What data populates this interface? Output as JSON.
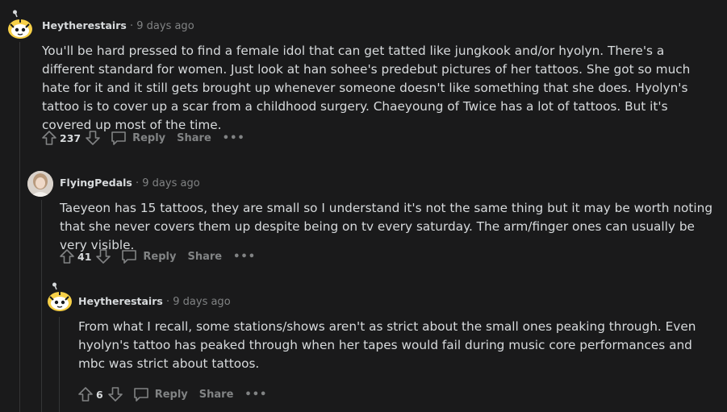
{
  "comments": [
    {
      "author": "Heytherestairs",
      "time": "9 days ago",
      "body": "You'll be hard pressed to find a female idol that can get tatted like jungkook and/or hyolyn. There's a different standard for women. Just look at han sohee's predebut pictures of her tattoos. She got so much hate for it and it still gets brought up whenever someone doesn't like something that she does. Hyolyn's tattoo is to cover up a scar from a childhood surgery. Chaeyoung of Twice has a lot of tattoos. But it's covered up most of the time.",
      "score": "237",
      "reply_label": "Reply",
      "share_label": "Share",
      "more_label": "•••"
    },
    {
      "author": "FlyingPedals",
      "time": "9 days ago",
      "body": "Taeyeon has 15 tattoos, they are small so I understand it's not the same thing but it may be worth noting that she never covers them up despite being on tv every saturday. The arm/finger ones can usually be very visible.",
      "score": "41",
      "reply_label": "Reply",
      "share_label": "Share",
      "more_label": "•••"
    },
    {
      "author": "Heytherestairs",
      "time": "9 days ago",
      "body": "From what I recall, some stations/shows aren't as strict about the small ones peaking through. Even hyolyn's tattoo has peaked through when her tapes would fail during music core performances and mbc was strict about tattoos.",
      "score": "6",
      "reply_label": "Reply",
      "share_label": "Share",
      "more_label": "•••"
    }
  ],
  "meta_separator": "·",
  "colors": {
    "background": "#1a1a1b",
    "text": "#d7dadc",
    "muted": "#818384",
    "thread_line": "#343536"
  }
}
